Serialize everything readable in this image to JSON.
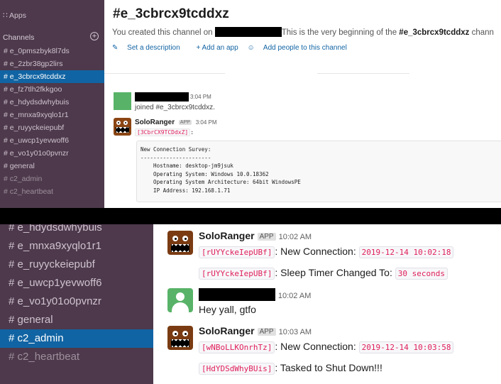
{
  "top": {
    "sidebar": {
      "apps_label": "Apps",
      "channels_label": "Channels",
      "add_icon": "plus-circle-icon",
      "channels": [
        {
          "label": "# e_0pmszbyk8l7ds",
          "state": "normal"
        },
        {
          "label": "# e_2zbr38gp2lirs",
          "state": "normal"
        },
        {
          "label": "# e_3cbrcx9tcddxz",
          "state": "selected"
        },
        {
          "label": "# e_fz7tlh2fkkgoo",
          "state": "normal"
        },
        {
          "label": "# e_hdydsdwhybuis",
          "state": "normal"
        },
        {
          "label": "# e_mnxa9xyqlo1r1",
          "state": "normal"
        },
        {
          "label": "# e_ruyyckeiepubf",
          "state": "normal"
        },
        {
          "label": "# e_uwcp1yevwoff6",
          "state": "normal"
        },
        {
          "label": "# e_vo1y01o0pvnzr",
          "state": "normal"
        },
        {
          "label": "# general",
          "state": "normal"
        },
        {
          "label": "# c2_admin",
          "state": "dim"
        },
        {
          "label": "# c2_heartbeat",
          "state": "dim"
        }
      ]
    },
    "channel_title": "#e_3cbrcx9tcddxz",
    "intro": {
      "prefix": "You created this channel on",
      "middle": "This is the very beginning of the",
      "channel": "#e_3cbrcx9tcddxz",
      "suffix": "chann"
    },
    "links": {
      "set_description": "Set a description",
      "add_app": "+ Add an app",
      "add_people": "Add people to this channel"
    },
    "messages": [
      {
        "time": "3:04 PM",
        "text": "joined #e_3cbrcx9tcddxz."
      },
      {
        "sender": "SoloRanger",
        "badge": "APP",
        "time": "3:04 PM",
        "code": "[3CbrCX9TCDdxZ]",
        "code_suffix": ":",
        "pre": "New Connection Survey:\n----------------------\n    Hostname: desktop-jm9jsuk\n    Operating System: Windows 10.0.18362\n    Operating System Architecture: 64bit WindowsPE\n    IP Address: 192.168.1.71"
      }
    ]
  },
  "bottom": {
    "sidebar": {
      "channels": [
        {
          "label": "# e_hdydsdwhybuis",
          "state": "normal"
        },
        {
          "label": "# e_mnxa9xyqlo1r1",
          "state": "normal"
        },
        {
          "label": "# e_ruyyckeiepubf",
          "state": "normal"
        },
        {
          "label": "# e_uwcp1yevwoff6",
          "state": "normal"
        },
        {
          "label": "# e_vo1y01o0pvnzr",
          "state": "normal"
        },
        {
          "label": "# general",
          "state": "normal"
        },
        {
          "label": "# c2_admin",
          "state": "selected"
        },
        {
          "label": "# c2_heartbeat",
          "state": "dim"
        }
      ]
    },
    "msg1": {
      "sender": "SoloRanger",
      "badge": "APP",
      "time": "10:02 AM",
      "line1_code": "[rUYYckeIepUBf]",
      "line1_text": ": New Connection:",
      "line1_value": "2019-12-14 10:02:18",
      "line2_code": "[rUYYckeIepUBf]",
      "line2_text": ": Sleep Timer Changed To:",
      "line2_value": "30 seconds"
    },
    "msg2": {
      "time": "10:02 AM",
      "text": "Hey yall, gtfo"
    },
    "msg3": {
      "sender": "SoloRanger",
      "badge": "APP",
      "time": "10:03 AM",
      "line1_code": "[wNBoLLKOnrhTz]",
      "line1_text": ": New Connection:",
      "line1_value": "2019-12-14 10:03:58",
      "line2_code": "[HdYDSdWhyBUis]",
      "line2_text": ": Tasked to Shut Down!!!"
    }
  },
  "colors": {
    "sidebar_bg": "#4d394b",
    "selected_bg": "#1164a3",
    "link": "#1264a3",
    "code_red": "#e01e5a"
  }
}
